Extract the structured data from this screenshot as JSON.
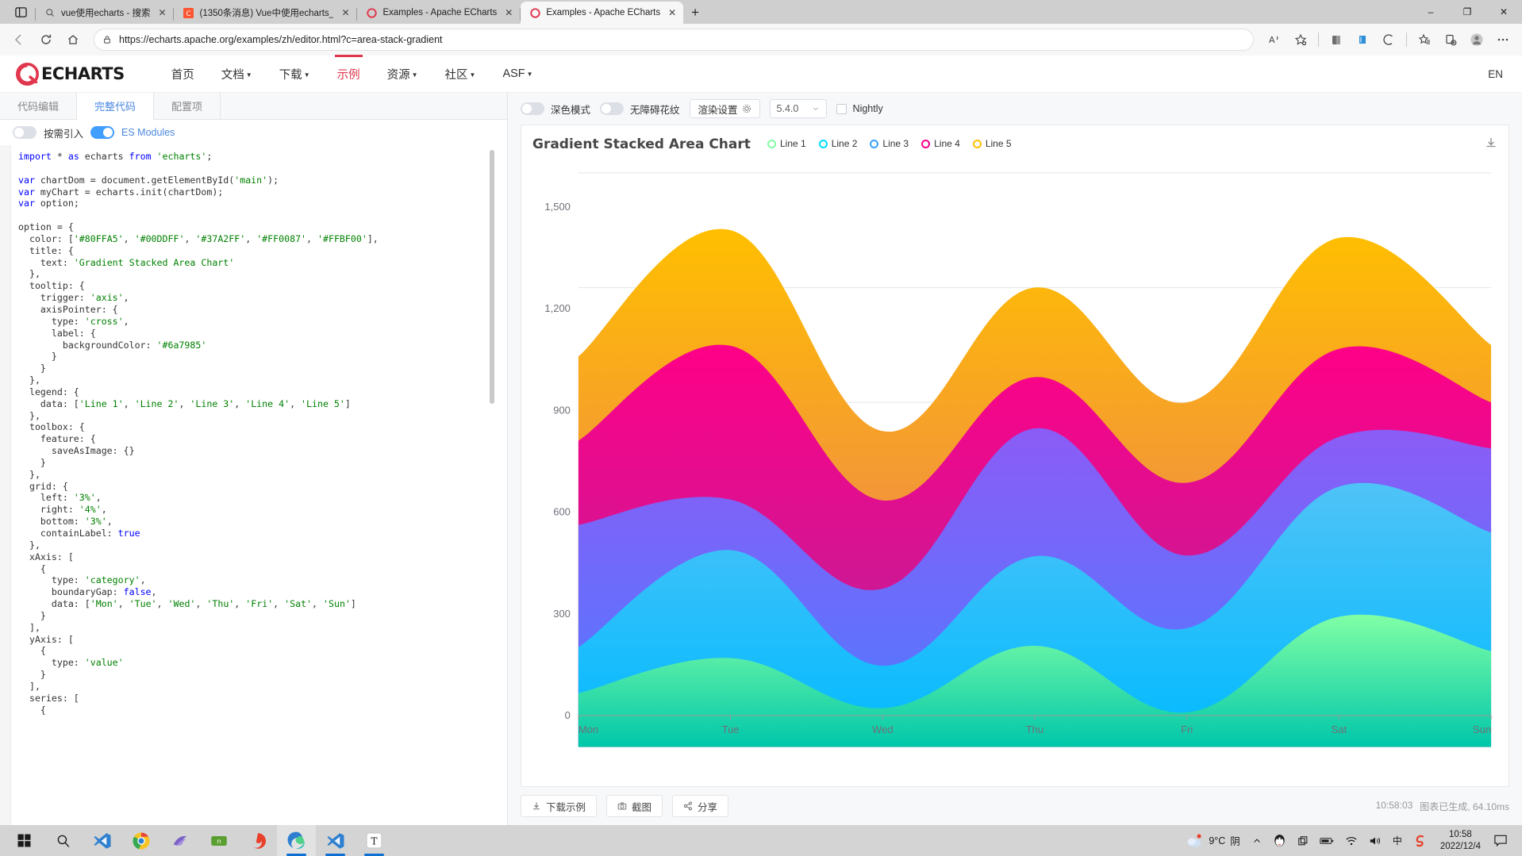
{
  "browser": {
    "tabs": [
      {
        "title": "vue使用echarts - 搜索",
        "favicon": "search-icon",
        "active": false
      },
      {
        "title": "(1350条消息) Vue中使用echarts_",
        "favicon": "csdn-icon",
        "active": false
      },
      {
        "title": "Examples - Apache ECharts",
        "favicon": "echarts-icon",
        "active": false
      },
      {
        "title": "Examples - Apache ECharts",
        "favicon": "echarts-icon",
        "active": true
      }
    ],
    "url": "https://echarts.apache.org/examples/zh/editor.html?c=area-stack-gradient",
    "new_tab_label": "+",
    "window_controls": {
      "minimize": "–",
      "maximize": "❐",
      "close": "✕"
    }
  },
  "site_nav": {
    "brand": "ECHARTS",
    "items": [
      {
        "label": "首页",
        "caret": false,
        "active": false
      },
      {
        "label": "文档",
        "caret": true,
        "active": false
      },
      {
        "label": "下载",
        "caret": true,
        "active": false
      },
      {
        "label": "示例",
        "caret": false,
        "active": true
      },
      {
        "label": "资源",
        "caret": true,
        "active": false
      },
      {
        "label": "社区",
        "caret": true,
        "active": false
      },
      {
        "label": "ASF",
        "caret": true,
        "active": false
      }
    ],
    "lang": "EN"
  },
  "editor": {
    "tabs": [
      {
        "label": "代码编辑",
        "active": false
      },
      {
        "label": "完整代码",
        "active": true
      },
      {
        "label": "配置项",
        "active": false
      }
    ],
    "toggles": [
      {
        "label": "按需引入",
        "on": false
      },
      {
        "label": "ES Modules",
        "on": true
      }
    ],
    "code": "import * as echarts from 'echarts';\n\nvar chartDom = document.getElementById('main');\nvar myChart = echarts.init(chartDom);\nvar option;\n\noption = {\n  color: ['#80FFA5', '#00DDFF', '#37A2FF', '#FF0087', '#FFBF00'],\n  title: {\n    text: 'Gradient Stacked Area Chart'\n  },\n  tooltip: {\n    trigger: 'axis',\n    axisPointer: {\n      type: 'cross',\n      label: {\n        backgroundColor: '#6a7985'\n      }\n    }\n  },\n  legend: {\n    data: ['Line 1', 'Line 2', 'Line 3', 'Line 4', 'Line 5']\n  },\n  toolbox: {\n    feature: {\n      saveAsImage: {}\n    }\n  },\n  grid: {\n    left: '3%',\n    right: '4%',\n    bottom: '3%',\n    containLabel: true\n  },\n  xAxis: [\n    {\n      type: 'category',\n      boundaryGap: false,\n      data: ['Mon', 'Tue', 'Wed', 'Thu', 'Fri', 'Sat', 'Sun']\n    }\n  ],\n  yAxis: [\n    {\n      type: 'value'\n    }\n  ],\n  series: [\n    {"
  },
  "chart_toolbar": {
    "dark_mode_label": "深色模式",
    "dark_mode_on": false,
    "accessible_pattern_label": "无障碍花纹",
    "accessible_pattern_on": false,
    "render_settings_label": "渲染设置",
    "version": "5.4.0",
    "nightly_label": "Nightly",
    "nightly_checked": false
  },
  "chart_data": {
    "type": "area",
    "title": "Gradient Stacked Area Chart",
    "stacked": true,
    "smooth": true,
    "categories": [
      "Mon",
      "Tue",
      "Wed",
      "Thu",
      "Fri",
      "Sat",
      "Sun"
    ],
    "xlabel": "",
    "ylabel": "",
    "ylim": [
      0,
      1500
    ],
    "yticks": [
      0,
      300,
      600,
      900,
      1200,
      1500
    ],
    "ytick_labels": [
      "0",
      "300",
      "600",
      "900",
      "1,200",
      "1,500"
    ],
    "grid": true,
    "legend_position": "top-center",
    "colors": [
      "#80FFA5",
      "#00DDFF",
      "#37A2FF",
      "#FF0087",
      "#FFBF00"
    ],
    "series": [
      {
        "name": "Line 1",
        "color": "#80FFA5",
        "gradient": [
          "#80FFA5",
          "#01C7AA"
        ],
        "values": [
          140,
          232,
          101,
          264,
          90,
          340,
          250
        ]
      },
      {
        "name": "Line 2",
        "color": "#00DDFF",
        "gradient": [
          "#4FC3F7",
          "#00BAFF"
        ],
        "values": [
          120,
          282,
          111,
          234,
          220,
          340,
          310
        ]
      },
      {
        "name": "Line 3",
        "color": "#37A2FF",
        "gradient": [
          "#8B5CF6",
          "#4E7BFF"
        ],
        "values": [
          320,
          132,
          201,
          334,
          190,
          130,
          220
        ]
      },
      {
        "name": "Line 4",
        "color": "#FF0087",
        "gradient": [
          "#FF0087",
          "#B0269C"
        ],
        "values": [
          220,
          402,
          231,
          134,
          190,
          230,
          120
        ]
      },
      {
        "name": "Line 5",
        "color": "#FFBF00",
        "gradient": [
          "#FFBF00",
          "#E8716B"
        ],
        "values": [
          220,
          302,
          181,
          234,
          210,
          290,
          150
        ]
      }
    ]
  },
  "chart_footer": {
    "buttons": [
      {
        "label": "下载示例",
        "icon": "download-icon"
      },
      {
        "label": "截图",
        "icon": "camera-icon"
      },
      {
        "label": "分享",
        "icon": "share-icon"
      }
    ],
    "status_time": "10:58:03",
    "status_text": "图表已生成, 64.10ms"
  },
  "taskbar": {
    "apps": [
      {
        "name": "start-button",
        "icon": "windows-icon"
      },
      {
        "name": "search-button",
        "icon": "search-icon"
      },
      {
        "name": "vscode",
        "icon": "vscode-icon"
      },
      {
        "name": "chrome",
        "icon": "chrome-icon"
      },
      {
        "name": "navicat",
        "icon": "navicat-icon"
      },
      {
        "name": "postman-like",
        "icon": "green-app-icon"
      },
      {
        "name": "red-app",
        "icon": "red-swirl-icon"
      },
      {
        "name": "edge",
        "icon": "edge-icon",
        "active": true,
        "running": true
      },
      {
        "name": "vscode-2",
        "icon": "vscode-icon",
        "running": true
      },
      {
        "name": "typora",
        "icon": "typora-icon",
        "running": true
      }
    ],
    "weather_temp": "9°C",
    "weather_text": "阴",
    "ime": "中",
    "time": "10:58",
    "date": "2022/12/4"
  }
}
